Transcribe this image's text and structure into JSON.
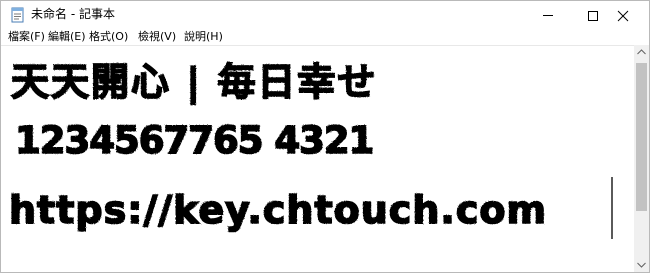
{
  "window": {
    "title": "未命名 - 記事本"
  },
  "menu": {
    "items": [
      {
        "label": "檔案(F)"
      },
      {
        "label": "編輯(E)"
      },
      {
        "label": "格式(O)"
      },
      {
        "label": "檢視(V)"
      },
      {
        "label": "說明(H)"
      }
    ]
  },
  "editor": {
    "lines": [
      "天天開心 | 毎日幸せ",
      "1234567765 4321",
      "https://key.chtouch.com"
    ]
  },
  "colors": {
    "text": "#000000",
    "scroll_thumb": "#c2c2c2",
    "scroll_track": "#f0f0f0"
  },
  "icons": [
    "notepad-icon",
    "minimize-icon",
    "maximize-icon",
    "close-icon",
    "scroll-up-arrow-icon",
    "scroll-down-arrow-icon"
  ]
}
